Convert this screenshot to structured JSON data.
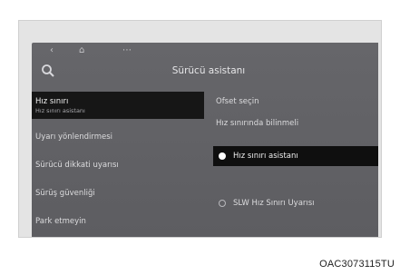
{
  "header": {
    "title": "Sürücü asistanı"
  },
  "status_bar": {
    "icons": [
      "back-icon",
      "home-icon",
      "menu-dots-icon"
    ]
  },
  "left_menu": {
    "items": [
      {
        "label": "Hız sınırı",
        "sublabel": "Hız sınırı asistanı",
        "selected": true
      },
      {
        "label": "Uyarı yönlendirmesi",
        "selected": false
      },
      {
        "label": "Sürücü dikkati uyarısı",
        "selected": false
      },
      {
        "label": "Sürüş güvenliği",
        "selected": false
      },
      {
        "label": "Park etmeyin",
        "selected": false
      }
    ]
  },
  "right_pane": {
    "options": [
      {
        "label": "Ofset seçin",
        "sublabel": ""
      },
      {
        "label": "Hız sınırında bilinmeli",
        "sublabel": ""
      },
      {
        "label": "Hız sınırı asistanı",
        "selected": true
      },
      {
        "label": "SLW Hız Sınırı Uyarısı",
        "selected": false
      }
    ]
  },
  "caption": "OAC3073115TU"
}
